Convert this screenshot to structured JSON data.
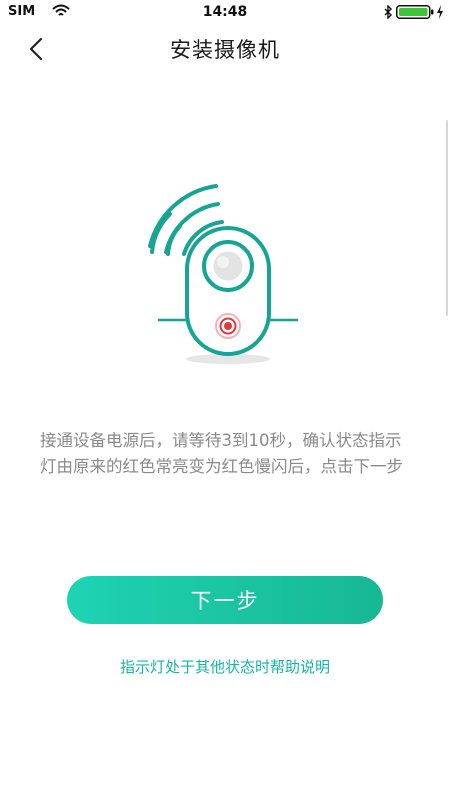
{
  "status_bar": {
    "carrier": "SIM",
    "time": "14:48",
    "icons": [
      "wifi-icon",
      "bluetooth-icon",
      "battery-icon",
      "charging-icon"
    ]
  },
  "nav": {
    "back_icon": "chevron-left-icon",
    "title": "安装摄像机"
  },
  "illustration": {
    "icon": "camera-signal-icon",
    "colors": {
      "body": "#16a594",
      "indicator": "#e8343c",
      "shadow": "#e6e6e6"
    }
  },
  "instruction": "接通设备电源后，请等待3到10秒，确认状态指示灯由原来的红色常亮变为红色慢闪后，点击下一步",
  "next_button": {
    "label": "下一步",
    "color_start": "#1ed3b4",
    "color_end": "#17b893"
  },
  "help_link": {
    "label": "指示灯处于其他状态时帮助说明",
    "color": "#14b7a4"
  }
}
